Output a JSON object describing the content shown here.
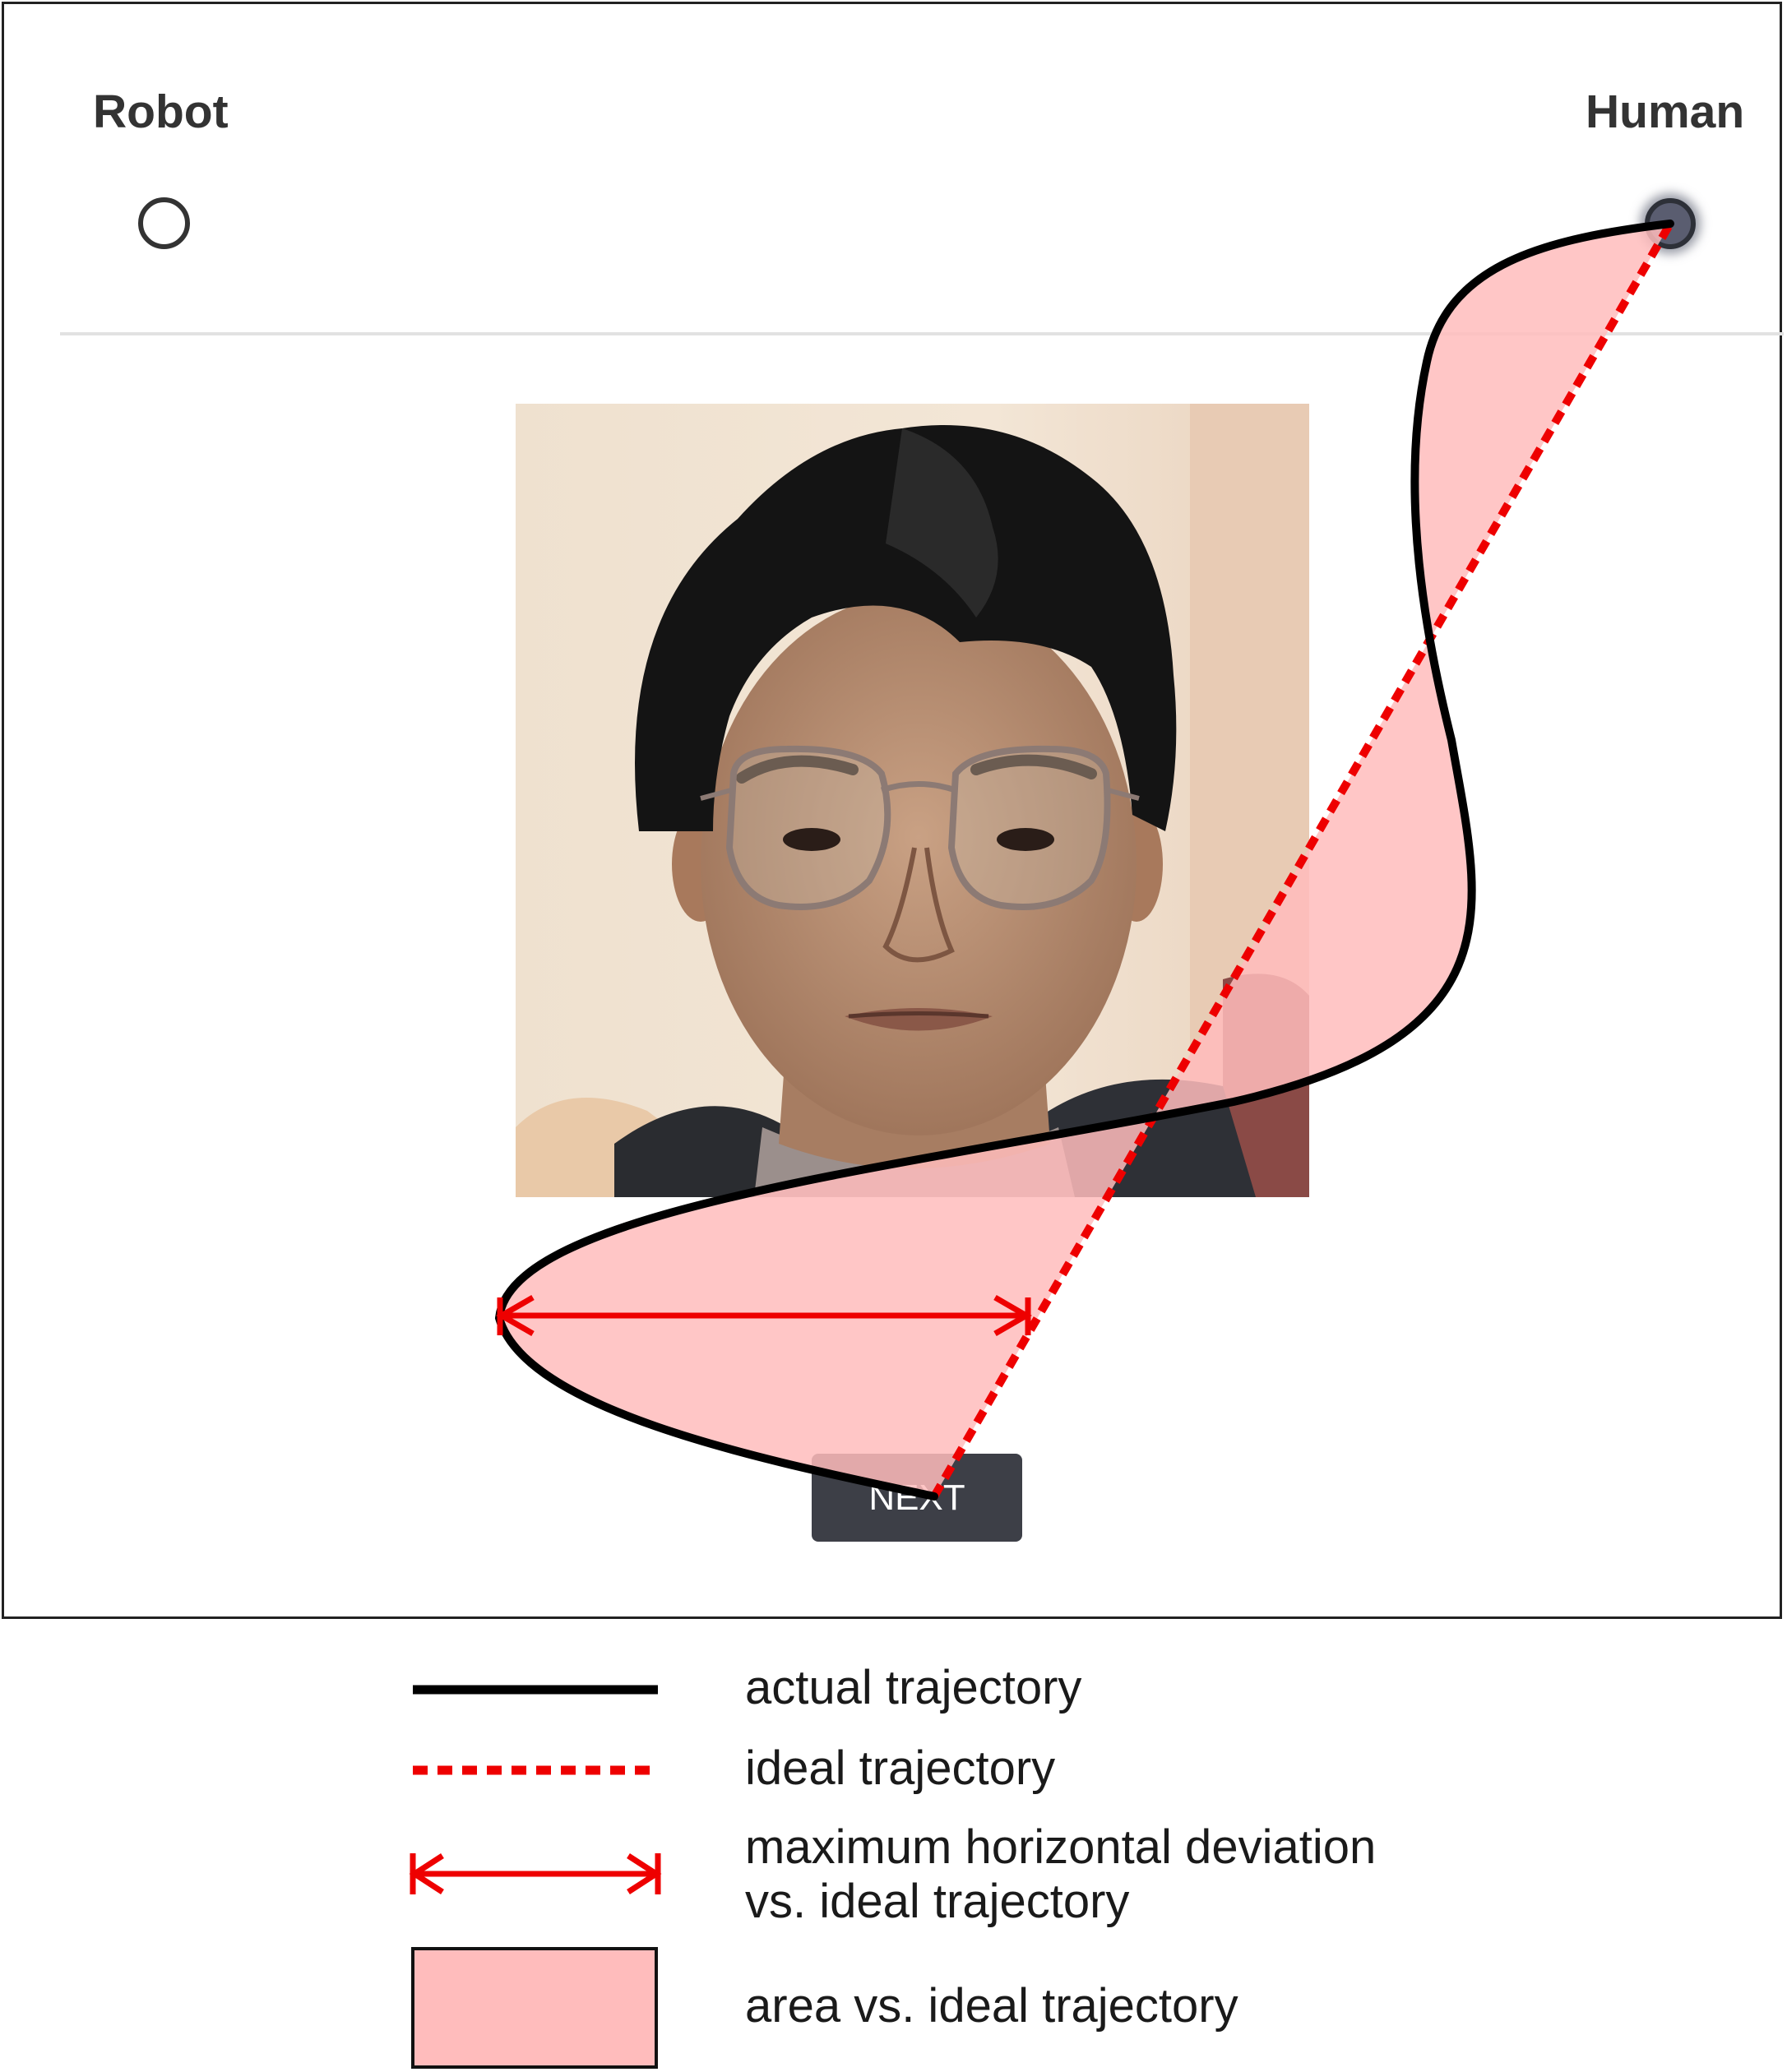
{
  "options": {
    "left_label": "Robot",
    "right_label": "Human"
  },
  "stimulus": {
    "image": "android-face-photo"
  },
  "next_button": {
    "label": "NEXT"
  },
  "legend": {
    "actual": "actual trajectory",
    "ideal": "ideal trajectory",
    "deviation_line1": "maximum horizontal deviation",
    "deviation_line2": "vs. ideal trajectory",
    "area": "area vs. ideal trajectory"
  },
  "colors": {
    "actual_trajectory": "#000000",
    "ideal_trajectory": "#ee0000",
    "deviation_arrow": "#ee0000",
    "area_fill": "#ffbcbc"
  }
}
